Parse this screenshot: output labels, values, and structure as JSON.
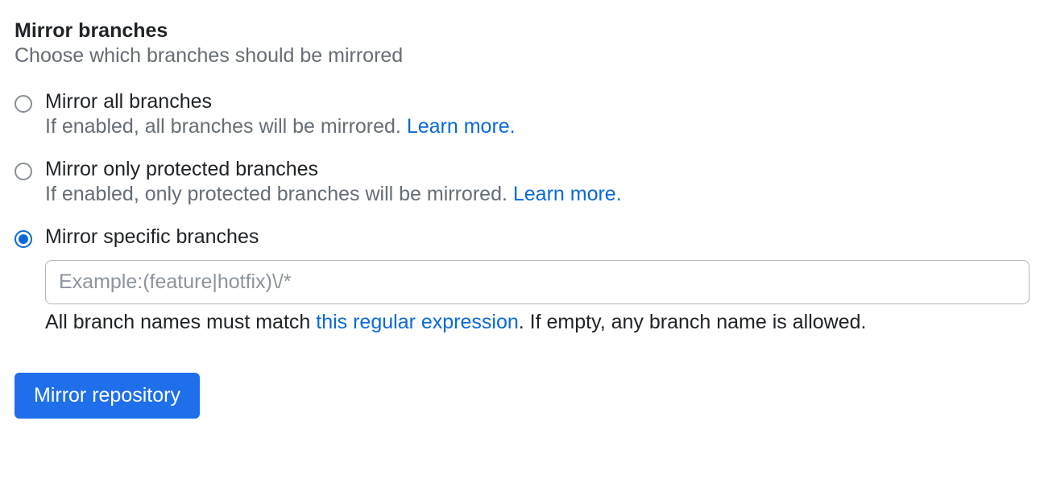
{
  "section": {
    "title": "Mirror branches",
    "subtitle": "Choose which branches should be mirrored"
  },
  "options": {
    "all": {
      "label": "Mirror all branches",
      "desc": "If enabled, all branches will be mirrored. ",
      "learn_more": "Learn more."
    },
    "protected": {
      "label": "Mirror only protected branches",
      "desc": "If enabled, only protected branches will be mirrored. ",
      "learn_more": "Learn more."
    },
    "specific": {
      "label": "Mirror specific branches",
      "input_value": "",
      "input_placeholder": "Example:(feature|hotfix)\\/*",
      "helper_before": "All branch names must match ",
      "helper_link": "this regular expression",
      "helper_after": ". If empty, any branch name is allowed."
    }
  },
  "button": {
    "submit": "Mirror repository"
  }
}
